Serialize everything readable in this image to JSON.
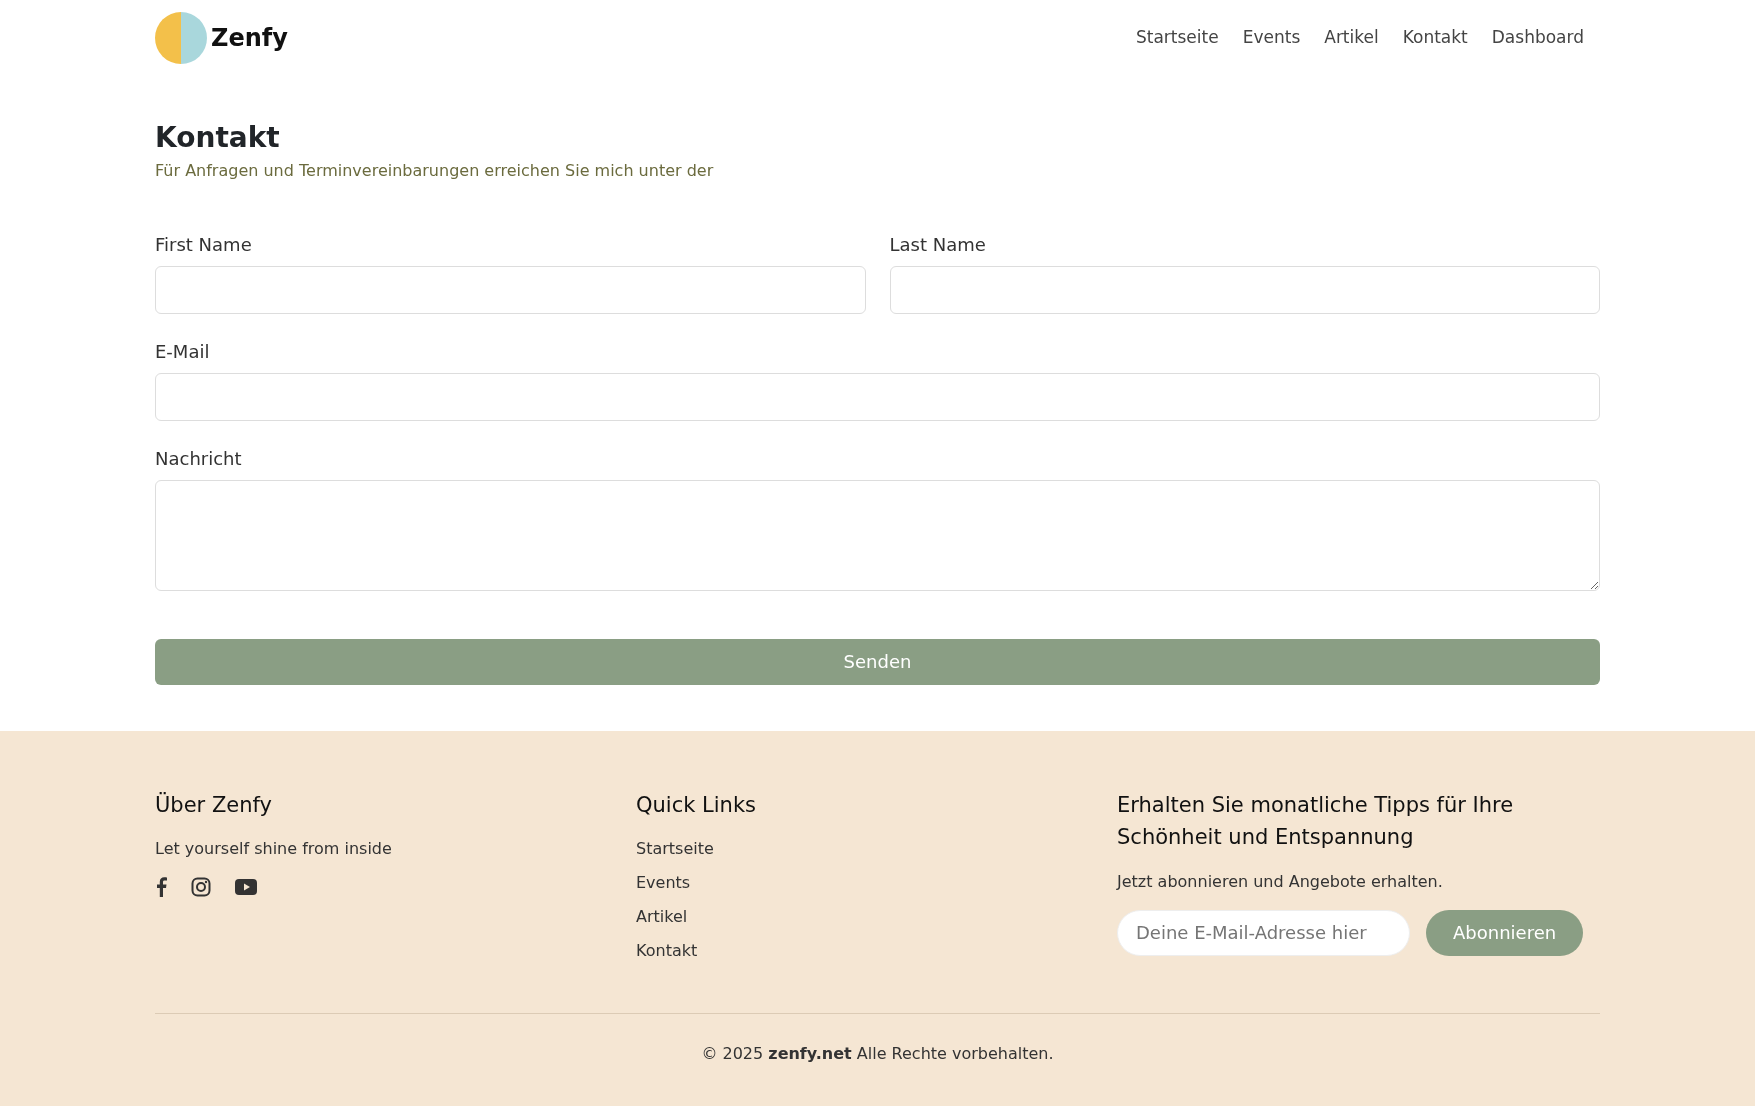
{
  "brand": {
    "name": "Zenfy"
  },
  "nav": [
    {
      "label": "Startseite"
    },
    {
      "label": "Events"
    },
    {
      "label": "Artikel"
    },
    {
      "label": "Kontakt"
    },
    {
      "label": "Dashboard"
    }
  ],
  "contact": {
    "title": "Kontakt",
    "subtitle": "Für Anfragen und Terminvereinbarungen erreichen Sie mich unter der",
    "rows": [
      [
        {
          "label": "First Name",
          "kind": "input"
        },
        {
          "label": "Last Name",
          "kind": "input"
        }
      ],
      [
        {
          "label": "E-Mail",
          "kind": "input"
        }
      ],
      [
        {
          "label": "Nachricht",
          "kind": "textarea"
        }
      ]
    ],
    "submit": "Senden"
  },
  "footer": {
    "about": {
      "title": "Über Zenfy",
      "text": "Let yourself shine from inside"
    },
    "quick_links": {
      "title": "Quick Links",
      "links": [
        "Startseite",
        "Events",
        "Artikel",
        "Kontakt"
      ]
    },
    "newsletter": {
      "title": "Erhalten Sie monatliche Tipps für Ihre Schönheit und Entspannung",
      "text": "Jetzt abonnieren und Angebote erhalten.",
      "placeholder": "Deine E-Mail-Adresse hier",
      "button": "Abonnieren"
    },
    "copyright": "© 2025 **zenfy.net** Alle Rechte vorbehalten."
  }
}
